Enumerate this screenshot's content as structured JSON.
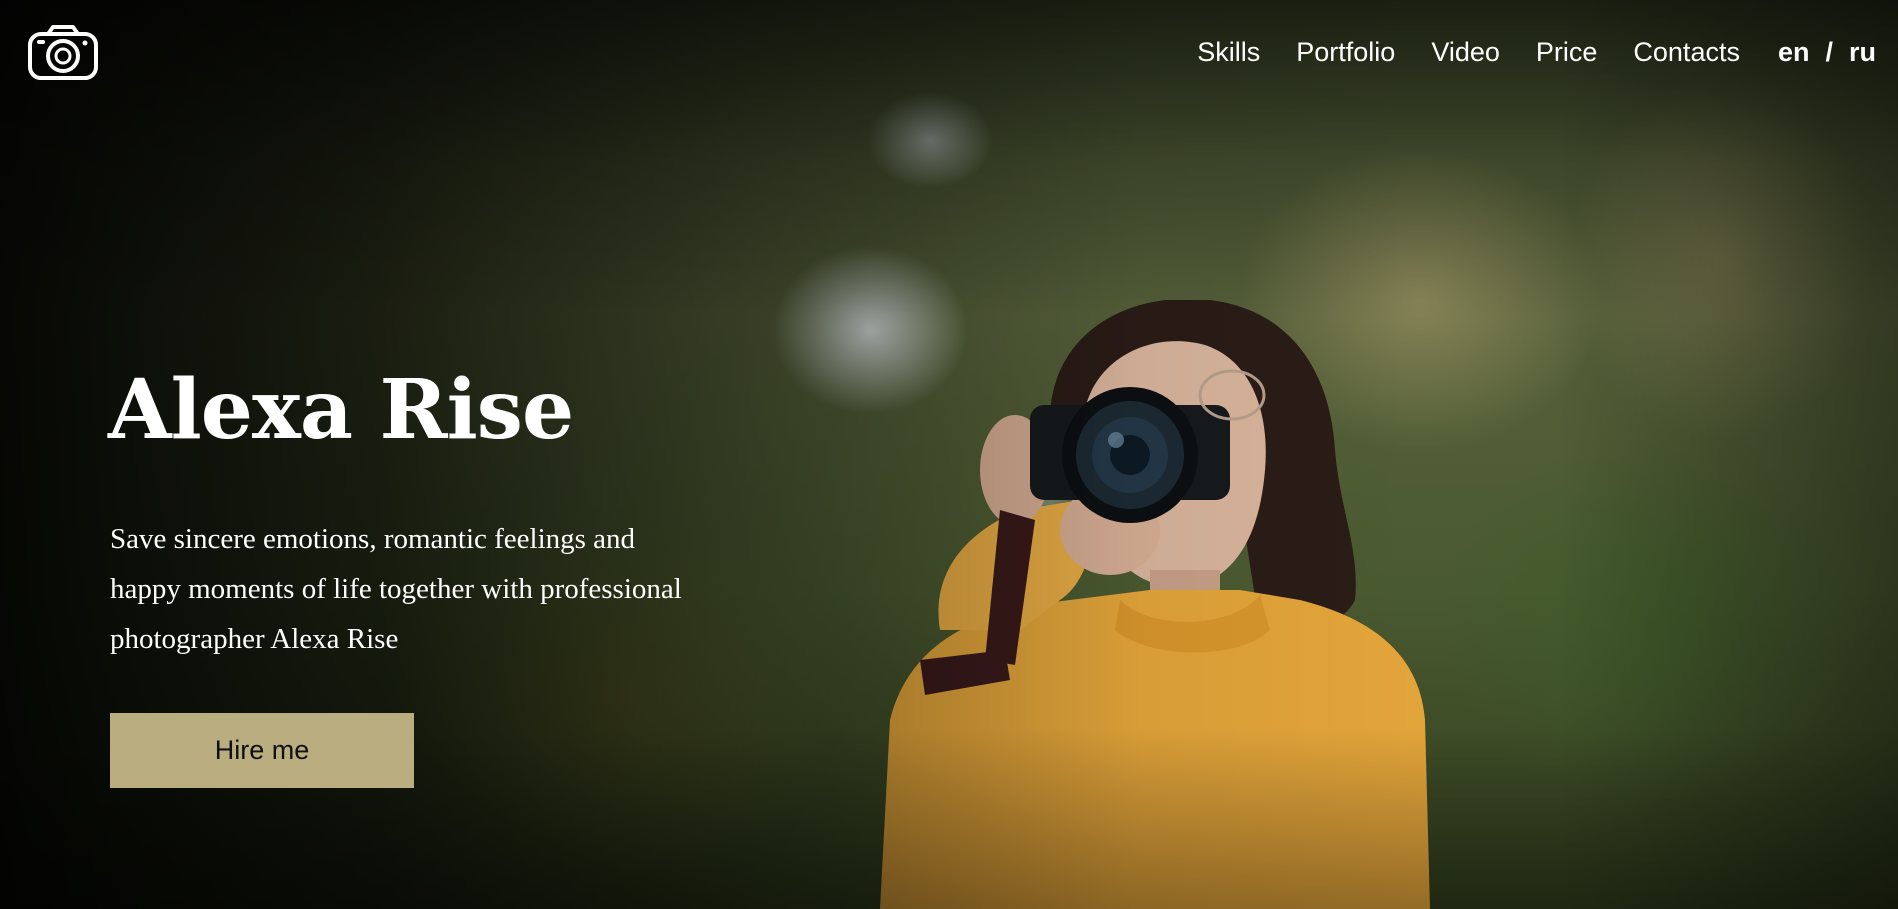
{
  "header": {
    "logo_icon": "camera-icon",
    "nav_links": [
      "Skills",
      "Portfolio",
      "Video",
      "Price",
      "Contacts"
    ],
    "languages": {
      "active": "en",
      "separator": "/",
      "alternate": "ru"
    }
  },
  "hero": {
    "title": "Alexa Rise",
    "tagline": "Save sincere emotions, romantic feelings and happy moments of life together with professional photographer Alexa Rise",
    "cta_label": "Hire me",
    "background": "photographer-with-camera-in-forest"
  },
  "colors": {
    "cta_background": "#baae80",
    "text": "#ffffff",
    "sweater": "#e3a53a"
  }
}
